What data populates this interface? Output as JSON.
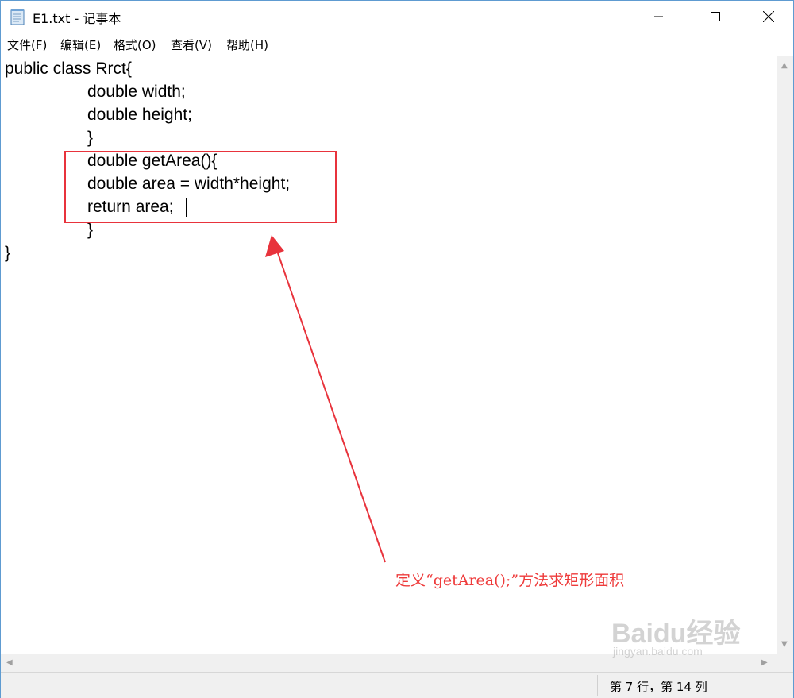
{
  "window": {
    "title": "E1.txt - 记事本"
  },
  "menu": {
    "items": [
      "文件(F)",
      "编辑(E)",
      "格式(O)",
      "查看(V)",
      "帮助(H)"
    ]
  },
  "editor": {
    "lines": [
      "public class Rrct{",
      "double width;",
      "double height;",
      "}",
      "double getArea(){",
      "double area = width*height;",
      "return area;",
      "}",
      "}"
    ]
  },
  "status": {
    "position": "第 7 行，第 14 列"
  },
  "annotation": {
    "text": "定义“getArea();”方法求矩形面积",
    "color": "#ee3b3b"
  },
  "watermark": {
    "brand": "Baidu经验",
    "url": "jingyan.baidu.com"
  }
}
